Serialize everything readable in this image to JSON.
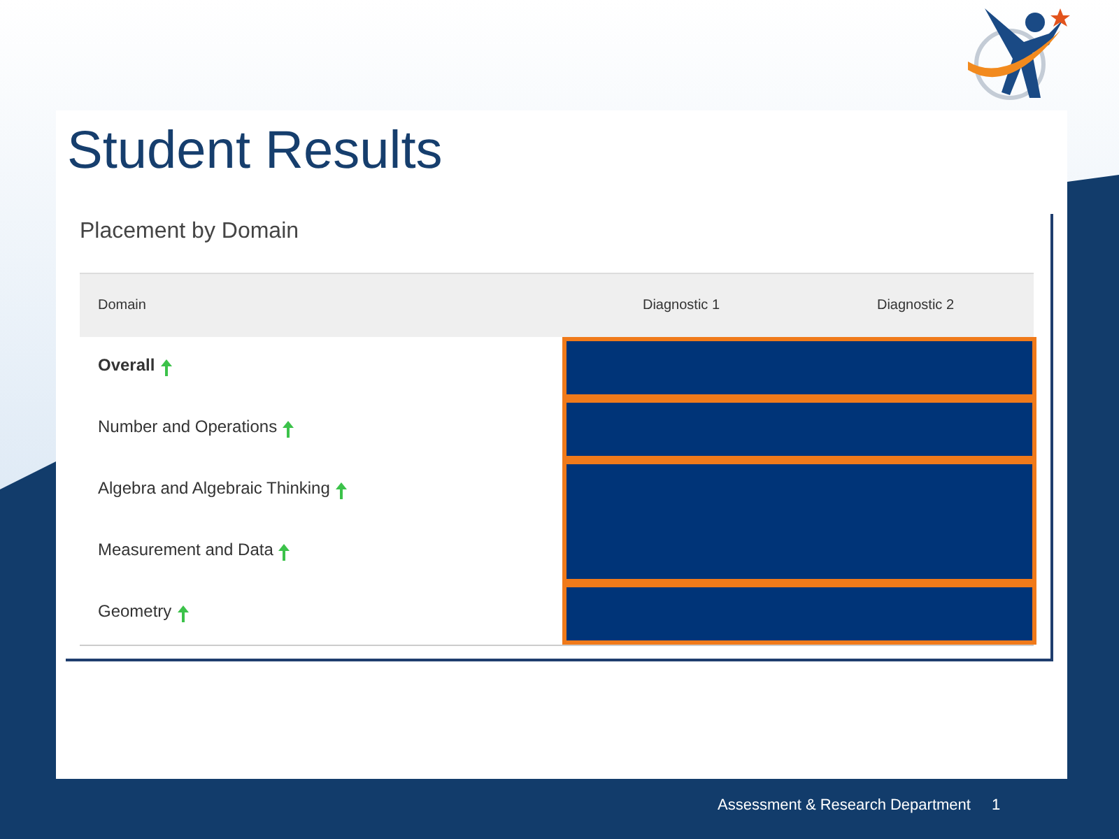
{
  "slide": {
    "title": "Student Results",
    "footer": "Assessment & Research Department",
    "page_number": "1"
  },
  "card": {
    "title": "Placement by Domain",
    "columns": [
      "Domain",
      "Diagnostic 1",
      "Diagnostic 2"
    ],
    "rows": [
      {
        "kind": "total",
        "domain": "Overall",
        "improved": true,
        "mask_start": true
      },
      {
        "kind": "domain",
        "domain": "Number and Operations",
        "improved": true,
        "mask_start": true
      },
      {
        "kind": "domain",
        "domain": "Algebra and Algebraic Thinking",
        "improved": true,
        "mask_start": true
      },
      {
        "kind": "domain",
        "domain": "Measurement and Data",
        "improved": true,
        "mask_start": false
      },
      {
        "kind": "domain",
        "domain": "Geometry",
        "improved": true,
        "mask_start": true
      }
    ]
  }
}
